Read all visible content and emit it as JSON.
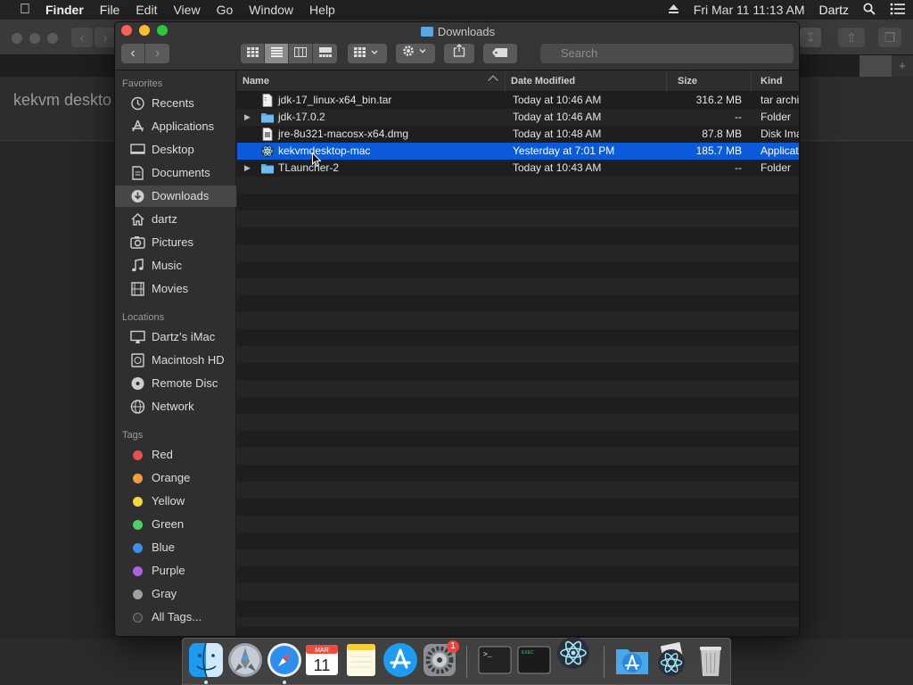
{
  "menubar": {
    "app_name": "Finder",
    "items": [
      "File",
      "Edit",
      "View",
      "Go",
      "Window",
      "Help"
    ],
    "clock": "Fri Mar 11  11:13 AM",
    "user": "Dartz"
  },
  "background_app": {
    "heading": "kekvm deskto"
  },
  "window": {
    "title": "Downloads",
    "search_placeholder": "Search"
  },
  "sidebar": {
    "favorites_header": "Favorites",
    "favorites": [
      {
        "label": "Recents",
        "icon": "recents-icon"
      },
      {
        "label": "Applications",
        "icon": "applications-icon"
      },
      {
        "label": "Desktop",
        "icon": "desktop-icon"
      },
      {
        "label": "Documents",
        "icon": "documents-icon"
      },
      {
        "label": "Downloads",
        "icon": "downloads-icon",
        "selected": true
      },
      {
        "label": "dartz",
        "icon": "home-icon"
      },
      {
        "label": "Pictures",
        "icon": "pictures-icon"
      },
      {
        "label": "Music",
        "icon": "music-icon"
      },
      {
        "label": "Movies",
        "icon": "movies-icon"
      }
    ],
    "locations_header": "Locations",
    "locations": [
      {
        "label": "Dartz’s iMac",
        "icon": "imac-icon"
      },
      {
        "label": "Macintosh HD",
        "icon": "harddisk-icon"
      },
      {
        "label": "Remote Disc",
        "icon": "disc-icon"
      },
      {
        "label": "Network",
        "icon": "network-icon"
      }
    ],
    "tags_header": "Tags",
    "tags": [
      {
        "label": "Red",
        "color": "#e94f4f"
      },
      {
        "label": "Orange",
        "color": "#f29d38"
      },
      {
        "label": "Yellow",
        "color": "#f5d932"
      },
      {
        "label": "Green",
        "color": "#4cd165"
      },
      {
        "label": "Blue",
        "color": "#3a8ff5"
      },
      {
        "label": "Purple",
        "color": "#b35ee6"
      },
      {
        "label": "Gray",
        "color": "#a0a0a0"
      },
      {
        "label": "All Tags...",
        "color": "#3b3b3b"
      }
    ]
  },
  "columns": {
    "name": "Name",
    "date": "Date Modified",
    "size": "Size",
    "kind": "Kind"
  },
  "files": [
    {
      "name": "jdk-17_linux-x64_bin.tar",
      "date": "Today at 10:46 AM",
      "size": "316.2 MB",
      "kind": "tar archi",
      "type": "file"
    },
    {
      "name": "jdk-17.0.2",
      "date": "Today at 10:46 AM",
      "size": "--",
      "kind": "Folder",
      "type": "folder"
    },
    {
      "name": "jre-8u321-macosx-x64.dmg",
      "date": "Today at 10:48 AM",
      "size": "87.8 MB",
      "kind": "Disk Ima",
      "type": "file"
    },
    {
      "name": "kekvmdesktop-mac",
      "date": "Yesterday at 7:01 PM",
      "size": "185.7 MB",
      "kind": "Applicat",
      "type": "app",
      "selected": true
    },
    {
      "name": "TLauncher-2",
      "date": "Today at 10:43 AM",
      "size": "--",
      "kind": "Folder",
      "type": "folder"
    }
  ],
  "dock": {
    "calendar_month": "MAR",
    "calendar_day": "11",
    "settings_badge": "1",
    "terminal_prompt": ">_",
    "exec_label": "EXEC"
  },
  "colors": {
    "selection": "#0b5ad9",
    "folder": "#56a9e6"
  }
}
